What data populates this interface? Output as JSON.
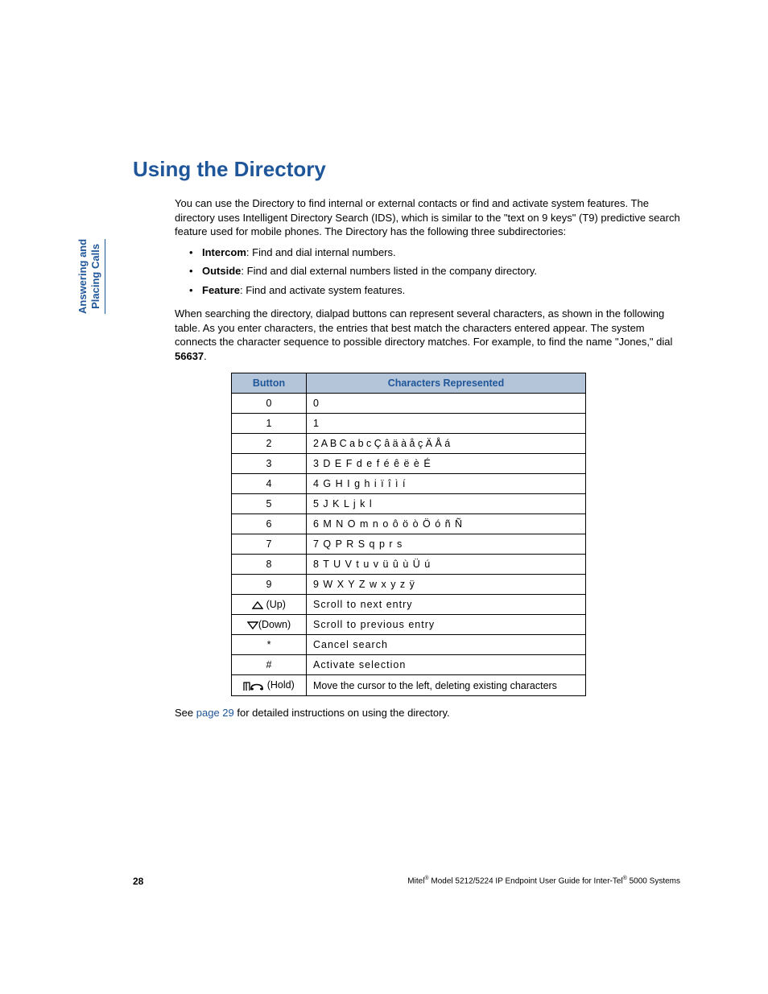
{
  "sideTab": {
    "line1": "Answering and",
    "line2": "Placing Calls"
  },
  "heading": "Using the Directory",
  "intro": "You can use the Directory to find internal or external contacts or find and activate system features. The directory uses Intelligent Directory Search (IDS), which is similar to the \"text on 9 keys\" (T9) predictive search feature used for mobile phones. The Directory has the following three subdirectories:",
  "bullets": [
    {
      "term": "Intercom",
      "desc": ": Find and dial internal numbers."
    },
    {
      "term": "Outside",
      "desc": ": Find and dial external numbers listed in the company directory."
    },
    {
      "term": "Feature",
      "desc": ": Find and activate system features."
    }
  ],
  "para2_a": "When searching the directory, dialpad buttons can represent several characters, as shown in the following table. As you enter characters, the entries that best match the characters entered appear. The system connects the character sequence to possible directory matches. For example, to find the name \"Jones,\" dial ",
  "para2_b_bold": "56637",
  "para2_c": ".",
  "table": {
    "headers": {
      "button": "Button",
      "chars": "Characters Represented"
    },
    "rows": [
      {
        "button": "0",
        "chars": "0"
      },
      {
        "button": "1",
        "chars": "1"
      },
      {
        "button": "2",
        "chars": "2 A B C a b c Ç â ä à å ç Ä Å á"
      },
      {
        "button": "3",
        "chars": "3 D E F d e f é ê ë è É"
      },
      {
        "button": "4",
        "chars": "4 G H I g h i ï î ì í"
      },
      {
        "button": "5",
        "chars": "5 J K L j k l"
      },
      {
        "button": "6",
        "chars": "6 M N O m n o ô ö ò Ö ó ñ Ñ"
      },
      {
        "button": "7",
        "chars": "7 Q P R S q p r s"
      },
      {
        "button": "8",
        "chars": "8 T U V t u v ü û ù Ü ú"
      },
      {
        "button": "9",
        "chars": "9 W X Y Z w x y z ÿ"
      },
      {
        "button_icon": "up",
        "button_suffix": " (Up)",
        "chars": "Scroll to next entry"
      },
      {
        "button_icon": "down",
        "button_suffix": "(Down)",
        "chars": "Scroll to previous entry"
      },
      {
        "button": "*",
        "chars": "Cancel search"
      },
      {
        "button": "#",
        "chars": "Activate selection"
      },
      {
        "button_icon": "hold",
        "button_suffix": " (Hold)",
        "chars": "Move the cursor to the left, deleting existing characters"
      }
    ]
  },
  "seeText": {
    "before": "See ",
    "link": "page 29",
    "after": " for detailed instructions on using the directory."
  },
  "footer": {
    "page": "28",
    "text_a": "Mitel",
    "text_b": " Model 5212/5224 IP Endpoint User Guide for Inter-Tel",
    "text_c": " 5000 Systems",
    "reg": "®"
  }
}
